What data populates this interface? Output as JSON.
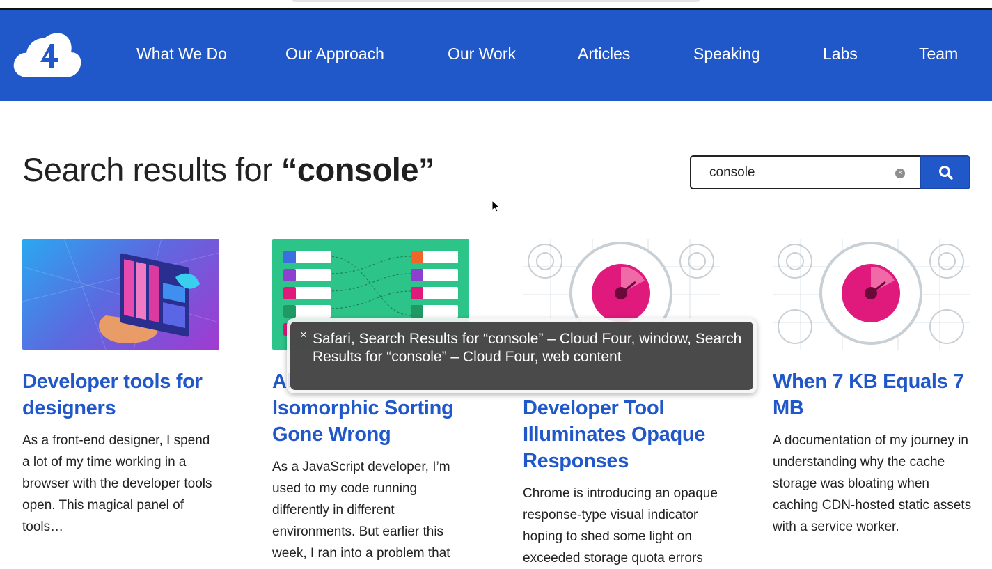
{
  "nav": {
    "items": [
      "What We Do",
      "Our Approach",
      "Our Work",
      "Articles",
      "Speaking",
      "Labs",
      "Team"
    ]
  },
  "page": {
    "title_prefix": "Search results for ",
    "title_query": "“console”"
  },
  "search": {
    "value": "console",
    "clear_label": "×"
  },
  "cards": [
    {
      "title": "Developer tools for designers",
      "body": "As a front-end designer, I spend a lot of my time working in a browser with the developer tools open. This magical panel of tools…"
    },
    {
      "title": "Al… Isomorphic Sorting Gone Wrong",
      "title_visible": "Isomorphic Sorting Gone Wrong",
      "title_fragment": "Al",
      "body": "As a JavaScript developer, I’m used to my code running differently in different environments. But earlier this week, I ran into a problem that"
    },
    {
      "title": "Developer Tool Illuminates Opaque Responses",
      "body": "Chrome is introducing an opaque response-type visual indicator hoping to shed some light on exceeded storage quota errors"
    },
    {
      "title": "When 7 KB Equals 7 MB",
      "body": "A documentation of my journey in understanding why the cache storage was bloating when caching CDN-hosted static assets with a service worker."
    }
  ],
  "voiceover": {
    "close_label": "×",
    "text": "Safari, Search Results for “console” – Cloud Four, window, Search Results for “console” – Cloud Four, web content"
  },
  "colors": {
    "brand": "#2158c9",
    "accent_pink": "#e0197d",
    "green": "#2dc48a"
  },
  "icons": {
    "logo": "cloud-four-logo-icon",
    "search": "search-icon",
    "clear": "clear-icon",
    "close": "close-icon",
    "cursor": "mouse-pointer-icon"
  }
}
